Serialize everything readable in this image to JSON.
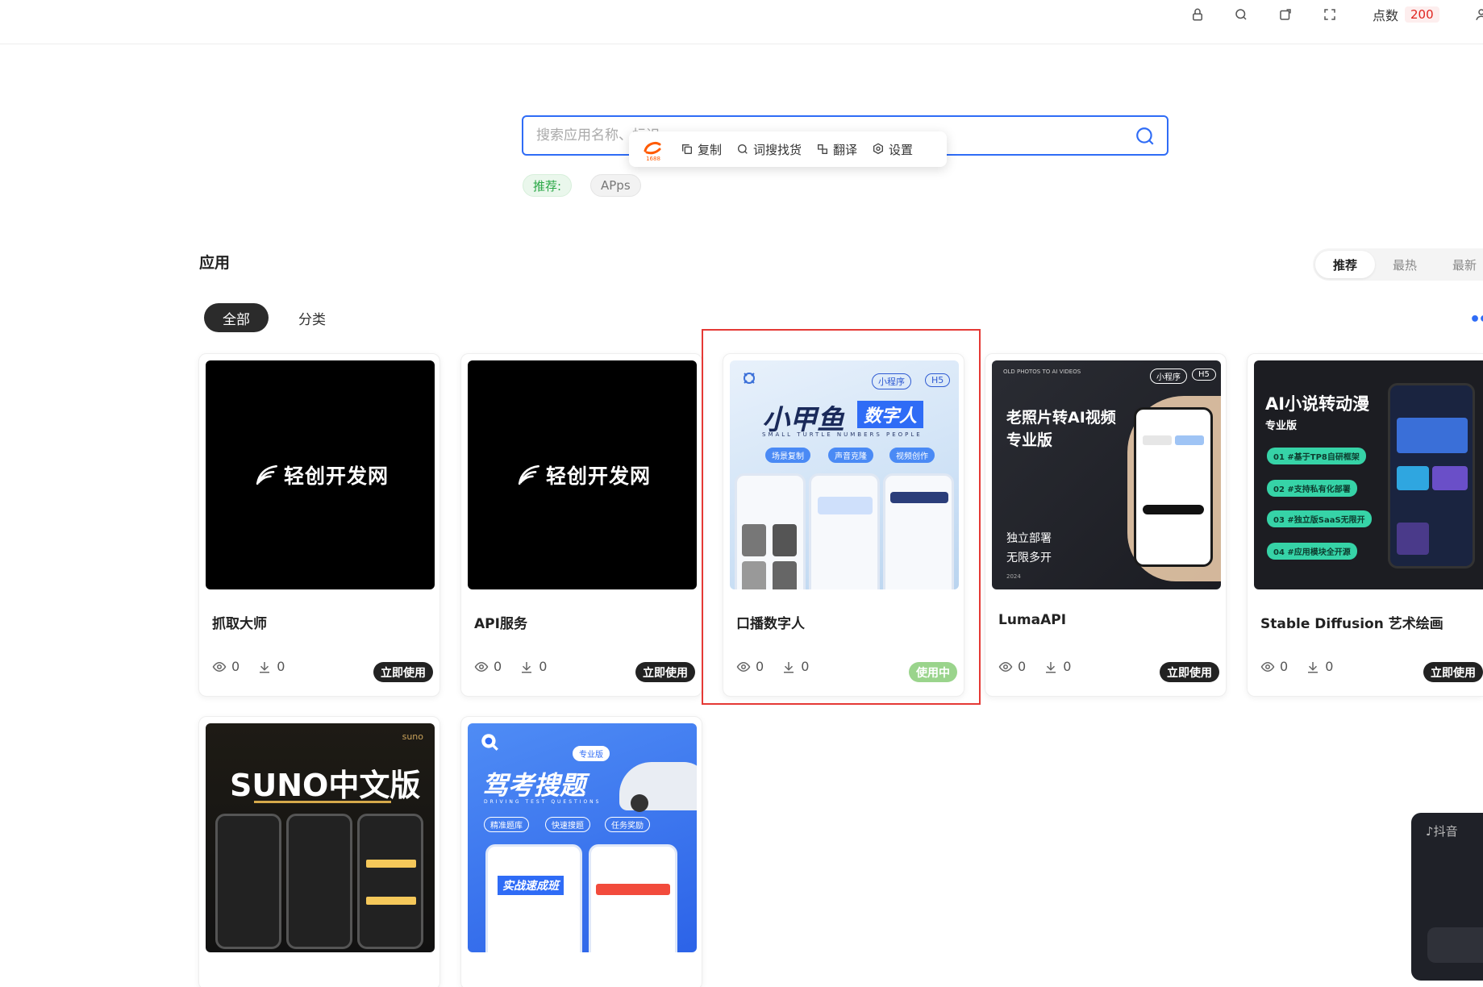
{
  "topbar": {
    "icons": [
      "lock-icon",
      "search-icon",
      "share-icon",
      "fullscreen-icon",
      "user-icon"
    ],
    "points_label": "点数",
    "points_value": "200"
  },
  "search": {
    "placeholder": "搜索应用名称、标识"
  },
  "popover": {
    "items": [
      {
        "label": "复制",
        "icon": "copy-icon"
      },
      {
        "label": "词搜找货",
        "icon": "search-icon"
      },
      {
        "label": "翻译",
        "icon": "translate-icon"
      },
      {
        "label": "设置",
        "icon": "settings-icon"
      }
    ],
    "logo_text": "1688"
  },
  "tags": {
    "recommend_label": "推荐:",
    "items": [
      "APps"
    ]
  },
  "section": {
    "title": "应用",
    "sort_tabs": [
      "推荐",
      "最热",
      "最新"
    ],
    "active_sort": "推荐",
    "filters": [
      "全部",
      "分类"
    ],
    "active_filter": "全部",
    "more": "••"
  },
  "cards": [
    {
      "title": "抓取大师",
      "views": "0",
      "downloads": "0",
      "button": "立即使用",
      "thumb_text": "轻创开发网"
    },
    {
      "title": "API服务",
      "views": "0",
      "downloads": "0",
      "button": "立即使用",
      "thumb_text": "轻创开发网"
    },
    {
      "title": "口播数字人",
      "views": "0",
      "downloads": "0",
      "button": "使用中",
      "thumb": {
        "tag1": "小程序",
        "tag2": "H5",
        "headline": "小甲鱼",
        "headline2": "数字人",
        "sub": "SMALL TURTLE NUMBERS PEOPLE",
        "features": [
          "场景复制",
          "声音克隆",
          "视频创作"
        ]
      }
    },
    {
      "title": "LumaAPI",
      "views": "0",
      "downloads": "0",
      "button": "立即使用",
      "thumb": {
        "top": "OLD PHOTOS TO AI VIDEOS",
        "tag1": "小程序",
        "tag2": "H5",
        "headline": "老照片转AI视频",
        "headline2": "专业版",
        "line1": "独立部署",
        "line2": "无限多开",
        "year": "2024"
      }
    },
    {
      "title": "Stable Diffusion 艺术绘画",
      "views": "0",
      "downloads": "0",
      "button": "立即使用",
      "thumb": {
        "headline": "AI小说转动漫",
        "sub": "专业版",
        "items": [
          "#基于TP8自研框架",
          "#支持私有化部署",
          "#独立版SaaS无限开",
          "#应用模块全开源"
        ],
        "nums": [
          "01",
          "02",
          "03",
          "04"
        ]
      }
    },
    {
      "title": "",
      "thumb": {
        "headline": "SUNO中文版",
        "corner": "suno"
      }
    },
    {
      "title": "",
      "thumb": {
        "tag": "专业版",
        "headline": "驾考搜题",
        "sub": "DRIVING TEST QUESTIONS",
        "features": [
          "精准题库",
          "快速搜题",
          "任务奖励"
        ],
        "banner": "实战速成班"
      }
    }
  ],
  "douyin": {
    "label": "抖音"
  }
}
